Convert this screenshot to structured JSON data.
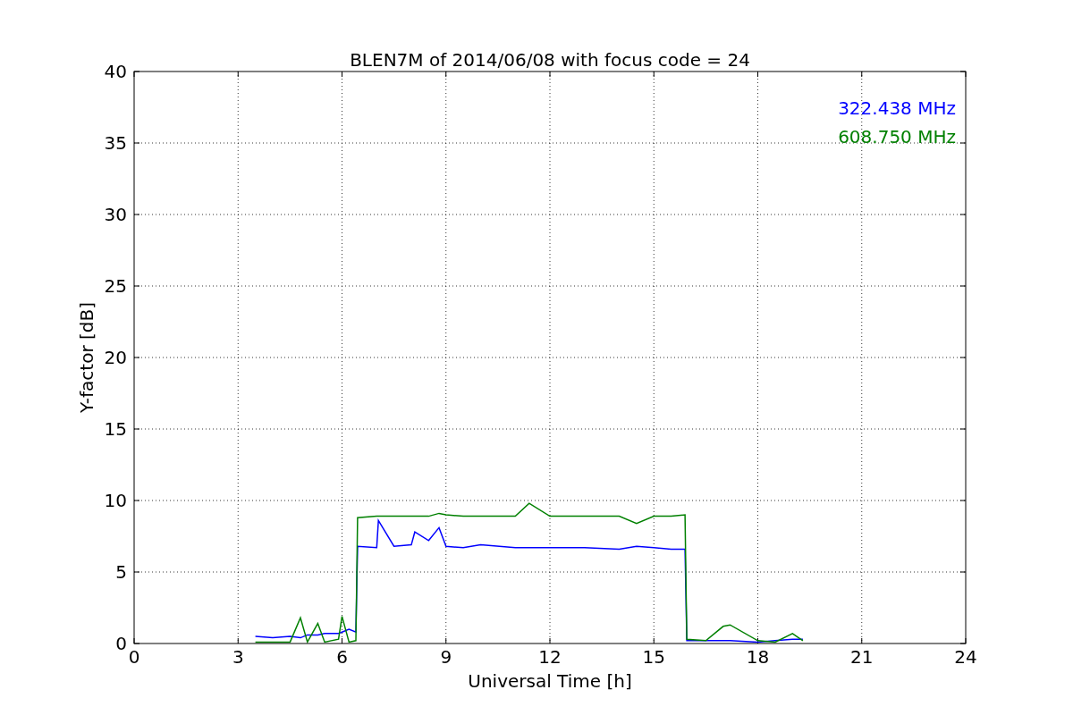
{
  "chart_data": {
    "type": "line",
    "title": "BLEN7M of 2014/06/08 with focus code = 24",
    "xlabel": "Universal Time [h]",
    "ylabel": "Y-factor [dB]",
    "xlim": [
      0,
      24
    ],
    "ylim": [
      0,
      40
    ],
    "grid": true,
    "xticks": [
      0,
      3,
      6,
      9,
      12,
      15,
      18,
      21,
      24
    ],
    "yticks": [
      0,
      5,
      10,
      15,
      20,
      25,
      30,
      35,
      40
    ],
    "x": [
      3.5,
      4,
      4.5,
      4.8,
      5,
      5.3,
      5.5,
      5.9,
      6,
      6.2,
      6.4,
      6.45,
      7,
      7.05,
      7.5,
      8,
      8.1,
      8.5,
      8.8,
      9,
      9.5,
      10,
      11,
      11.4,
      12,
      13,
      14,
      14.5,
      15,
      15.5,
      15.9,
      15.95,
      16.5,
      17,
      17.2,
      18,
      18.5,
      19,
      19.3
    ],
    "series": [
      {
        "name": "322.438 MHz",
        "color": "#0000ff",
        "values": [
          0.5,
          0.4,
          0.5,
          0.4,
          0.6,
          0.6,
          0.7,
          0.7,
          0.8,
          1.0,
          0.8,
          6.8,
          6.7,
          8.6,
          6.8,
          6.9,
          7.8,
          7.2,
          8.1,
          6.8,
          6.7,
          6.9,
          6.7,
          6.7,
          6.7,
          6.7,
          6.6,
          6.8,
          6.7,
          6.6,
          6.6,
          0.2,
          0.2,
          0.2,
          0.2,
          0.1,
          0.2,
          0.3,
          0.3
        ]
      },
      {
        "name": "608.750 MHz",
        "color": "#008000",
        "values": [
          0.1,
          0.1,
          0.1,
          1.8,
          0.1,
          1.4,
          0.1,
          0.3,
          1.9,
          0.1,
          0.2,
          8.8,
          8.9,
          8.9,
          8.9,
          8.9,
          8.9,
          8.9,
          9.1,
          9.0,
          8.9,
          8.9,
          8.9,
          9.8,
          8.9,
          8.9,
          8.9,
          8.4,
          8.9,
          8.9,
          9.0,
          0.3,
          0.2,
          1.2,
          1.3,
          0.2,
          0.1,
          0.7,
          0.2
        ]
      }
    ]
  }
}
